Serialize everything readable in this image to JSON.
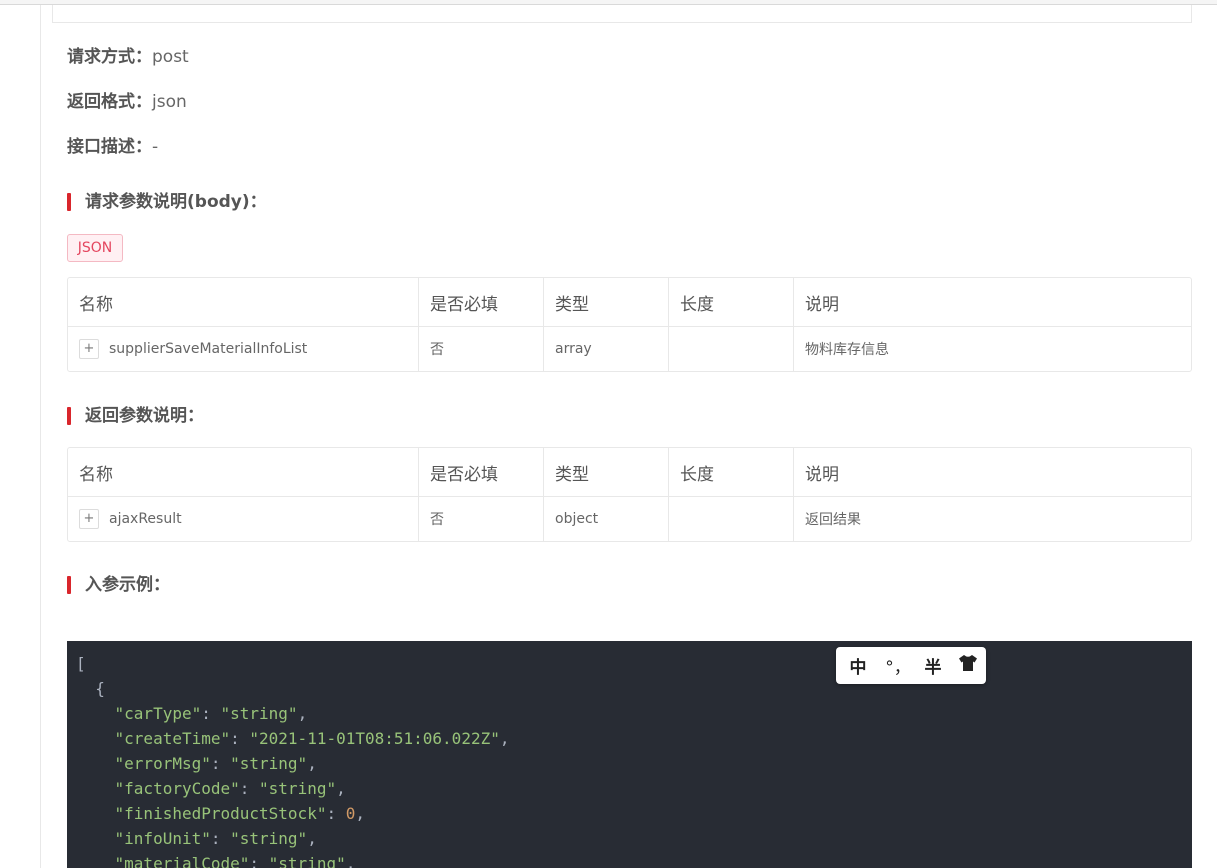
{
  "meta": {
    "method_label": "请求方式：",
    "method_value": "post",
    "format_label": "返回格式：",
    "format_value": "json",
    "desc_label": "接口描述：",
    "desc_value": "-"
  },
  "request_section": {
    "title": "请求参数说明(body)：",
    "tag": "JSON",
    "columns": [
      "名称",
      "是否必填",
      "类型",
      "长度",
      "说明"
    ],
    "rows": [
      {
        "expand": "+",
        "name": "supplierSaveMaterialInfoList",
        "required": "否",
        "type": "array",
        "length": "",
        "desc": "物料库存信息"
      }
    ]
  },
  "response_section": {
    "title": "返回参数说明：",
    "columns": [
      "名称",
      "是否必填",
      "类型",
      "长度",
      "说明"
    ],
    "rows": [
      {
        "expand": "+",
        "name": "ajaxResult",
        "required": "否",
        "type": "object",
        "length": "",
        "desc": "返回结果"
      }
    ]
  },
  "example_section": {
    "title": "入参示例：",
    "code": {
      "open_bracket": "[",
      "open_brace": "{",
      "fields": [
        {
          "key": "\"carType\"",
          "sep": ": ",
          "value": "\"string\"",
          "trail": ",",
          "kind": "string"
        },
        {
          "key": "\"createTime\"",
          "sep": ": ",
          "value": "\"2021-11-01T08:51:06.022Z\"",
          "trail": ",",
          "kind": "string"
        },
        {
          "key": "\"errorMsg\"",
          "sep": ": ",
          "value": "\"string\"",
          "trail": ",",
          "kind": "string"
        },
        {
          "key": "\"factoryCode\"",
          "sep": ": ",
          "value": "\"string\"",
          "trail": ",",
          "kind": "string"
        },
        {
          "key": "\"finishedProductStock\"",
          "sep": ": ",
          "value": "0",
          "trail": ",",
          "kind": "number"
        },
        {
          "key": "\"infoUnit\"",
          "sep": ": ",
          "value": "\"string\"",
          "trail": ",",
          "kind": "string"
        },
        {
          "key": "\"materialCode\"",
          "sep": ": ",
          "value": "\"string\"",
          "trail": ",",
          "kind": "string"
        }
      ]
    }
  },
  "ime_toolbar": {
    "lang": "中",
    "punct": "°，",
    "width": "半",
    "skin_icon": "shirt-icon"
  },
  "colors": {
    "accent_red": "#d9262c",
    "tag_text": "#e4465f",
    "code_bg": "#282c34",
    "code_string": "#98c379",
    "code_number": "#d19a66"
  }
}
